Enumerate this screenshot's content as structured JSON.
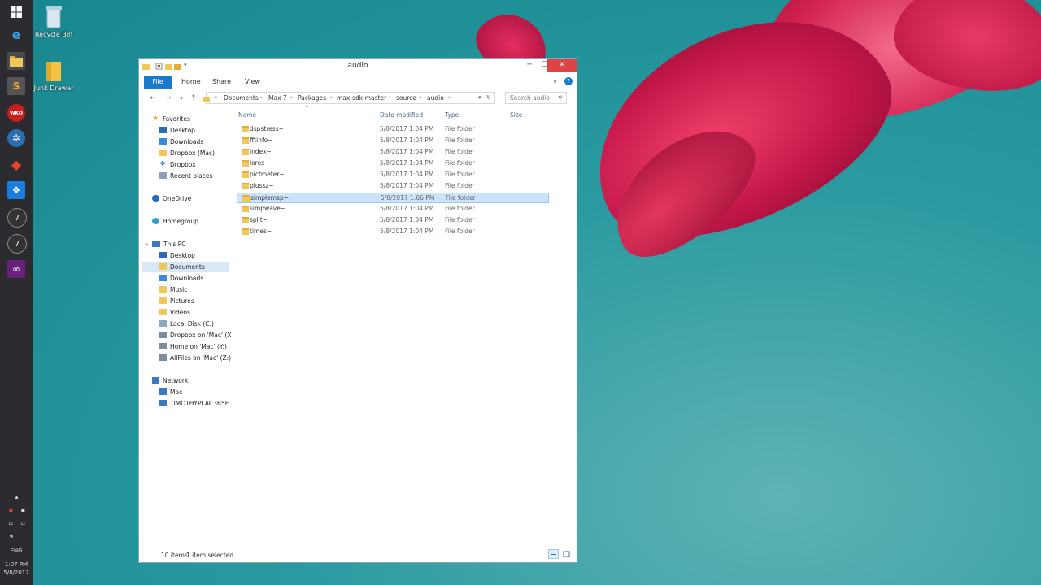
{
  "desktop": {
    "icons": [
      {
        "label": "Recycle Bin",
        "icon": "recycle-bin-icon"
      },
      {
        "label": "Junk Drawer",
        "icon": "folder-icon"
      }
    ]
  },
  "taskbar": {
    "icons": [
      "windows-start-icon",
      "internet-explorer-icon",
      "file-explorer-icon",
      "sublime-text-icon",
      "wko-icon",
      "app-icon",
      "git-icon",
      "dropbox-icon",
      "max7-icon",
      "max7-icon",
      "visual-studio-icon"
    ],
    "lang": "ENG",
    "time": "1:07 PM",
    "date": "5/8/2017"
  },
  "window": {
    "title": "audio",
    "ribbon": {
      "file": "File",
      "tabs": [
        "Home",
        "Share",
        "View"
      ]
    },
    "address": {
      "prefix": "«",
      "crumbs": [
        "Documents",
        "Max 7",
        "Packages",
        "max-sdk-master",
        "source",
        "audio"
      ]
    },
    "search_placeholder": "Search audio",
    "nav": {
      "favorites": {
        "label": "Favorites",
        "items": [
          "Desktop",
          "Downloads",
          "Dropbox (Mac)",
          "Dropbox",
          "Recent places"
        ]
      },
      "onedrive": "OneDrive",
      "homegroup": "Homegroup",
      "thispc": {
        "label": "This PC",
        "items": [
          "Desktop",
          "Documents",
          "Downloads",
          "Music",
          "Pictures",
          "Videos",
          "Local Disk (C:)",
          "Dropbox on 'Mac' (X",
          "Home on 'Mac' (Y:)",
          "AllFiles on 'Mac' (Z:)"
        ]
      },
      "network": {
        "label": "Network",
        "items": [
          "Mac",
          "TIMOTHYPLAC3B5E"
        ]
      }
    },
    "columns": {
      "name": "Name",
      "date": "Date modified",
      "type": "Type",
      "size": "Size"
    },
    "files": [
      {
        "name": "dspstress~",
        "date": "5/8/2017 1:04 PM",
        "type": "File folder"
      },
      {
        "name": "fftinfo~",
        "date": "5/8/2017 1:04 PM",
        "type": "File folder"
      },
      {
        "name": "index~",
        "date": "5/8/2017 1:04 PM",
        "type": "File folder"
      },
      {
        "name": "lores~",
        "date": "5/8/2017 1:04 PM",
        "type": "File folder"
      },
      {
        "name": "pictmeter~",
        "date": "5/8/2017 1:04 PM",
        "type": "File folder"
      },
      {
        "name": "plussz~",
        "date": "5/8/2017 1:04 PM",
        "type": "File folder"
      },
      {
        "name": "simplemsp~",
        "date": "5/8/2017 1:06 PM",
        "type": "File folder"
      },
      {
        "name": "simpwave~",
        "date": "5/8/2017 1:04 PM",
        "type": "File folder"
      },
      {
        "name": "split~",
        "date": "5/8/2017 1:04 PM",
        "type": "File folder"
      },
      {
        "name": "times~",
        "date": "5/8/2017 1:04 PM",
        "type": "File folder"
      }
    ],
    "selected_index": 6,
    "status": {
      "count": "10 items",
      "selected": "1 item selected"
    }
  },
  "colors": {
    "accent": "#1979ca",
    "selection": "#cce4fb",
    "close": "#e04343"
  }
}
